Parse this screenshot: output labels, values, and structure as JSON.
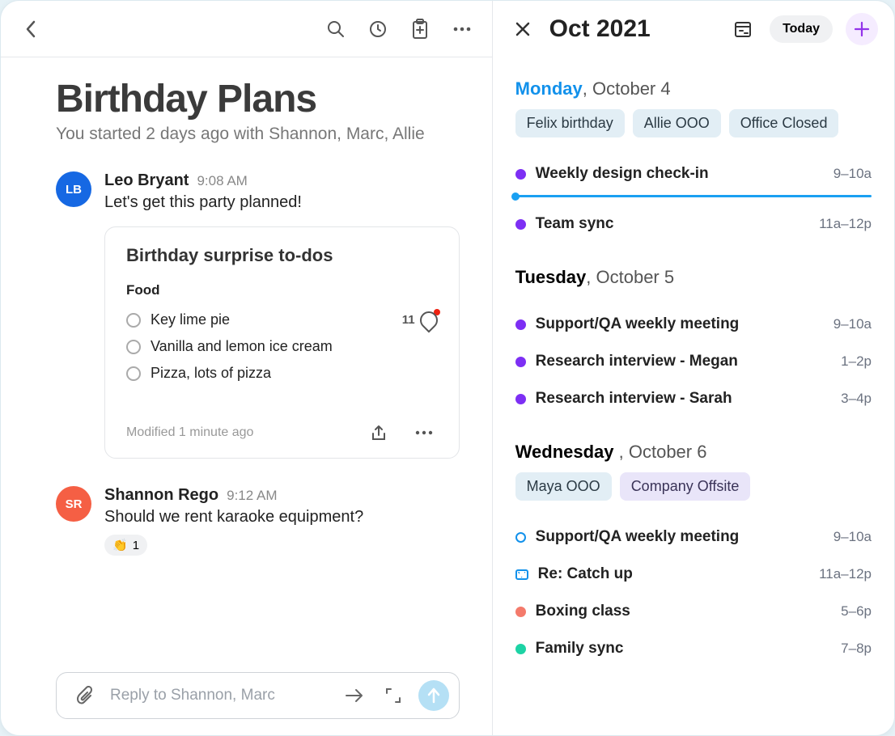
{
  "thread": {
    "title": "Birthday Plans",
    "subtitle": "You started 2 days ago with Shannon, Marc, Allie"
  },
  "messages": [
    {
      "author": "Leo Bryant",
      "initials": "LB",
      "avatar_color": "blue",
      "time": "9:08 AM",
      "text": "Let's get this party planned!",
      "card": {
        "title": "Birthday surprise to-dos",
        "section": "Food",
        "todos": [
          {
            "label": "Key lime pie",
            "comments": "11",
            "has_unread": true
          },
          {
            "label": "Vanilla and lemon ice cream"
          },
          {
            "label": "Pizza, lots of pizza"
          }
        ],
        "modified": "Modified 1 minute ago"
      }
    },
    {
      "author": "Shannon Rego",
      "initials": "SR",
      "avatar_color": "orange",
      "time": "9:12 AM",
      "text": "Should we rent karaoke equipment?",
      "reaction": {
        "emoji": "👏",
        "count": "1"
      }
    }
  ],
  "composer": {
    "placeholder": "Reply to Shannon, Marc"
  },
  "calendar": {
    "month_label": "Oct 2021",
    "today_label": "Today",
    "days": [
      {
        "dow": "Monday",
        "rest": ", October 4",
        "current": true,
        "chips": [
          {
            "label": "Felix birthday",
            "style": "blue"
          },
          {
            "label": "Allie OOO",
            "style": "blue"
          },
          {
            "label": "Office Closed",
            "style": "blue"
          }
        ],
        "events": [
          {
            "title": "Weekly design check-in",
            "time": "9–10a",
            "dot": "purple",
            "now_after": true
          },
          {
            "title": "Team sync",
            "time": "11a–12p",
            "dot": "purple"
          }
        ]
      },
      {
        "dow": "Tuesday",
        "rest": ", October 5",
        "current": false,
        "chips": [],
        "events": [
          {
            "title": "Support/QA weekly meeting",
            "time": "9–10a",
            "dot": "purple"
          },
          {
            "title": "Research interview - Megan",
            "time": "1–2p",
            "dot": "purple"
          },
          {
            "title": "Research interview -  Sarah",
            "time": "3–4p",
            "dot": "purple"
          }
        ]
      },
      {
        "dow": "Wednesday ",
        "rest": ", October 6",
        "current": false,
        "chips": [
          {
            "label": "Maya OOO",
            "style": "blue"
          },
          {
            "label": "Company Offsite",
            "style": "purple"
          }
        ],
        "events": [
          {
            "title": "Support/QA weekly meeting",
            "time": "9–10a",
            "dot": "outline-blue"
          },
          {
            "title": "Re: Catch up",
            "time": "11a–12p",
            "icon": "mail"
          },
          {
            "title": "Boxing class",
            "time": "5–6p",
            "dot": "coral"
          },
          {
            "title": "Family sync",
            "time": "7–8p",
            "dot": "teal"
          }
        ]
      }
    ]
  }
}
